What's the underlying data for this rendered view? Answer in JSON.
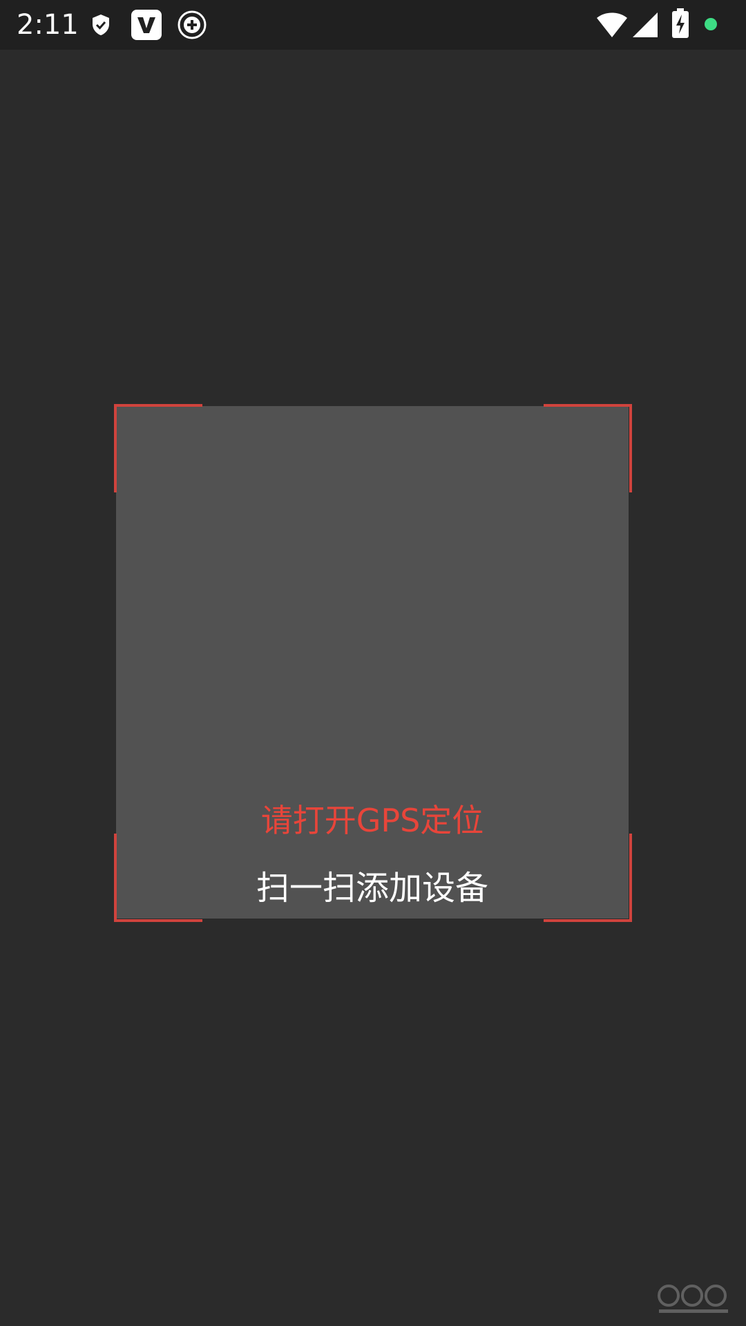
{
  "status_bar": {
    "time": "2:11",
    "icons": [
      "shield-icon",
      "v-app-icon",
      "plus-circle-icon",
      "wifi-icon",
      "signal-icon",
      "battery-charging-icon",
      "green-dot-icon"
    ]
  },
  "scanner": {
    "gps_hint": "请打开GPS定位",
    "scan_hint": "扫一扫添加设备"
  },
  "colors": {
    "background": "#2b2b2b",
    "scan_area": "#525252",
    "corner_accent": "#d0433d",
    "gps_hint": "#e8453a",
    "status_dot": "#3ddc84"
  }
}
